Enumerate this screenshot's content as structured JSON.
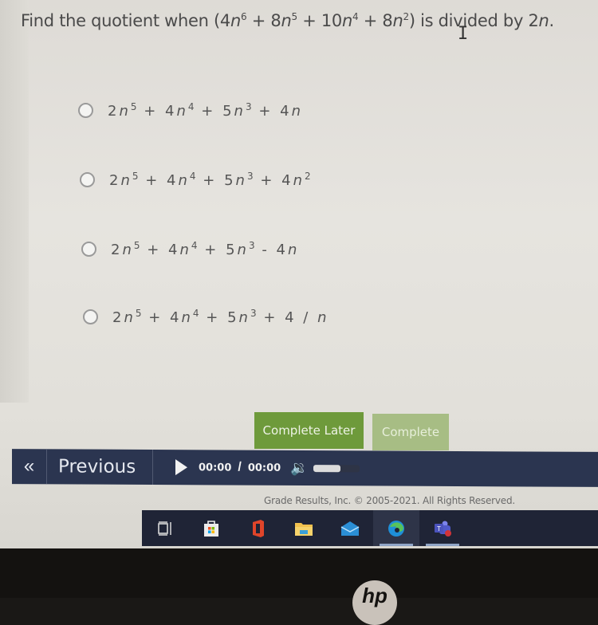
{
  "question": {
    "prefix": "Find the quotient when (4",
    "var": "n",
    "parts": [
      {
        "coef_before": "4",
        "exp": "6"
      },
      {
        "coef_before": " + 8",
        "exp": "5"
      },
      {
        "coef_before": " + 10",
        "exp": "4"
      },
      {
        "coef_before": " + 8",
        "exp": "2"
      }
    ],
    "p1": "Find the quotient when (4",
    "e1": "6",
    "p2": " + 8",
    "e2": "5",
    "p3": " + 10",
    "e3": "4",
    "p4": " + 8",
    "e4": "2",
    "p5": ") is divided by 2",
    "p6": "."
  },
  "options": [
    {
      "text": "2n^5 + 4n^4 + 5n^3 + 4n",
      "a": "2",
      "b": " + 4",
      "c": " + 5",
      "d": " + 4",
      "d_tail": "n",
      "d_exp": ""
    },
    {
      "text": "2n^5 + 4n^4 + 5n^3 + 4n^2",
      "a": "2",
      "b": " + 4",
      "c": " + 5",
      "d": " + 4",
      "d_tail": "n",
      "d_exp": "2"
    },
    {
      "text": "2n^5 + 4n^4 + 5n^3 - 4n",
      "a": "2",
      "b": " + 4",
      "c": " + 5",
      "d": " - 4",
      "d_tail": "n",
      "d_exp": ""
    },
    {
      "text": "2n^5 + 4n^4 + 5n^3 + 4/n",
      "a": "2",
      "b": " + 4",
      "c": " + 5",
      "d": " + 4 / ",
      "d_tail": "n",
      "d_exp": ""
    }
  ],
  "exps": {
    "e5": "5",
    "e4": "4",
    "e3": "3"
  },
  "var": "n",
  "buttons": {
    "complete_later": "Complete Later",
    "complete": "Complete"
  },
  "nav": {
    "first_icon": "«",
    "previous": "Previous",
    "current_time": "00:00",
    "separator": "/",
    "duration": "00:00",
    "volume_level": 0.6
  },
  "footer": "Grade Results, Inc. © 2005-2021. All Rights Reserved.",
  "taskbar": {
    "items": [
      "task-view",
      "microsoft-store",
      "office",
      "file-explorer",
      "mail",
      "edge",
      "teams"
    ]
  },
  "colors": {
    "primary_button": "#6e9a3b",
    "disabled_button": "#a7bd84",
    "navbar": "#2b3550",
    "taskbar": "#1f2436"
  },
  "brand": "hp"
}
